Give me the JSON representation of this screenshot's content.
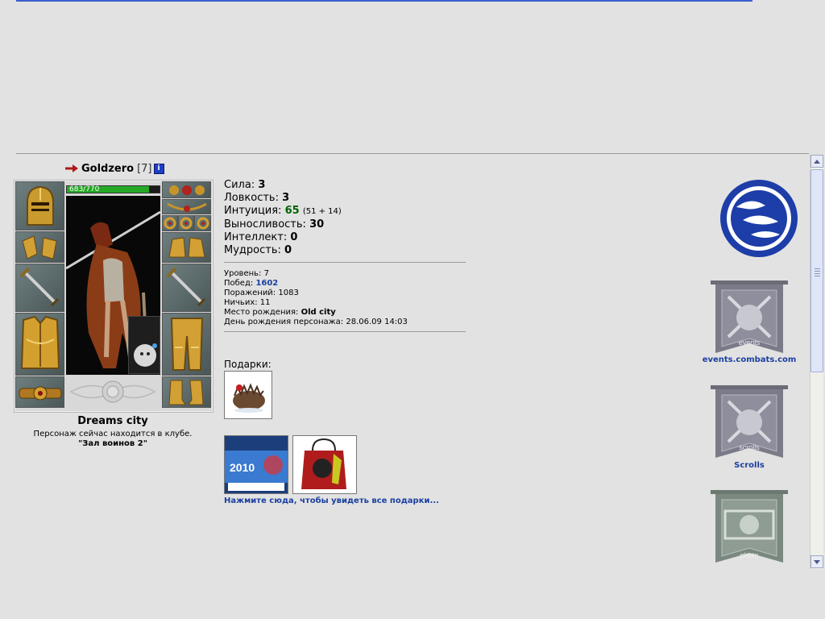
{
  "character": {
    "name": "Goldzero",
    "level": "[7]",
    "info_icon": "i",
    "hp": {
      "text": "683/770",
      "fraction": 0.887
    }
  },
  "location": {
    "city": "Dreams city",
    "status": "Персонаж сейчас находится в клубе.",
    "room": "\"Зал воинов 2\""
  },
  "stats": [
    {
      "label": "Сила:",
      "value": "3"
    },
    {
      "label": "Ловкость:",
      "value": "3"
    },
    {
      "label": "Интуиция:",
      "value": "65",
      "extra": "(51 + 14)"
    },
    {
      "label": "Выносливость:",
      "value": "30"
    },
    {
      "label": "Интеллект:",
      "value": "0"
    },
    {
      "label": "Мудрость:",
      "value": "0"
    }
  ],
  "info": {
    "level_label": "Уровень:",
    "level_value": "7",
    "wins_label": "Побед:",
    "wins_value": "1602",
    "losses_label": "Поражений:",
    "losses_value": "1083",
    "draws_label": "Ничьих:",
    "draws_value": "11",
    "birthplace_label": "Место рождения:",
    "birthplace_value": "Old city",
    "birthday_label": "День рождения персонажа:",
    "birthday_value": "28.06.09 14:03"
  },
  "gifts": {
    "label": "Подарки:",
    "more_link": "Нажмите сюда, чтобы увидеть все подарки...",
    "year_text": "2010"
  },
  "banners": [
    {
      "caption": "events.combats.com",
      "inner_text": "events"
    },
    {
      "caption": "Scrolls",
      "inner_text": "scrolls"
    },
    {
      "caption": "",
      "inner_text": "photo"
    }
  ],
  "colors": {
    "background": "#e2e2e2",
    "link": "#1a3fa0",
    "hp": "#25a825",
    "club": "#1d3da8"
  }
}
